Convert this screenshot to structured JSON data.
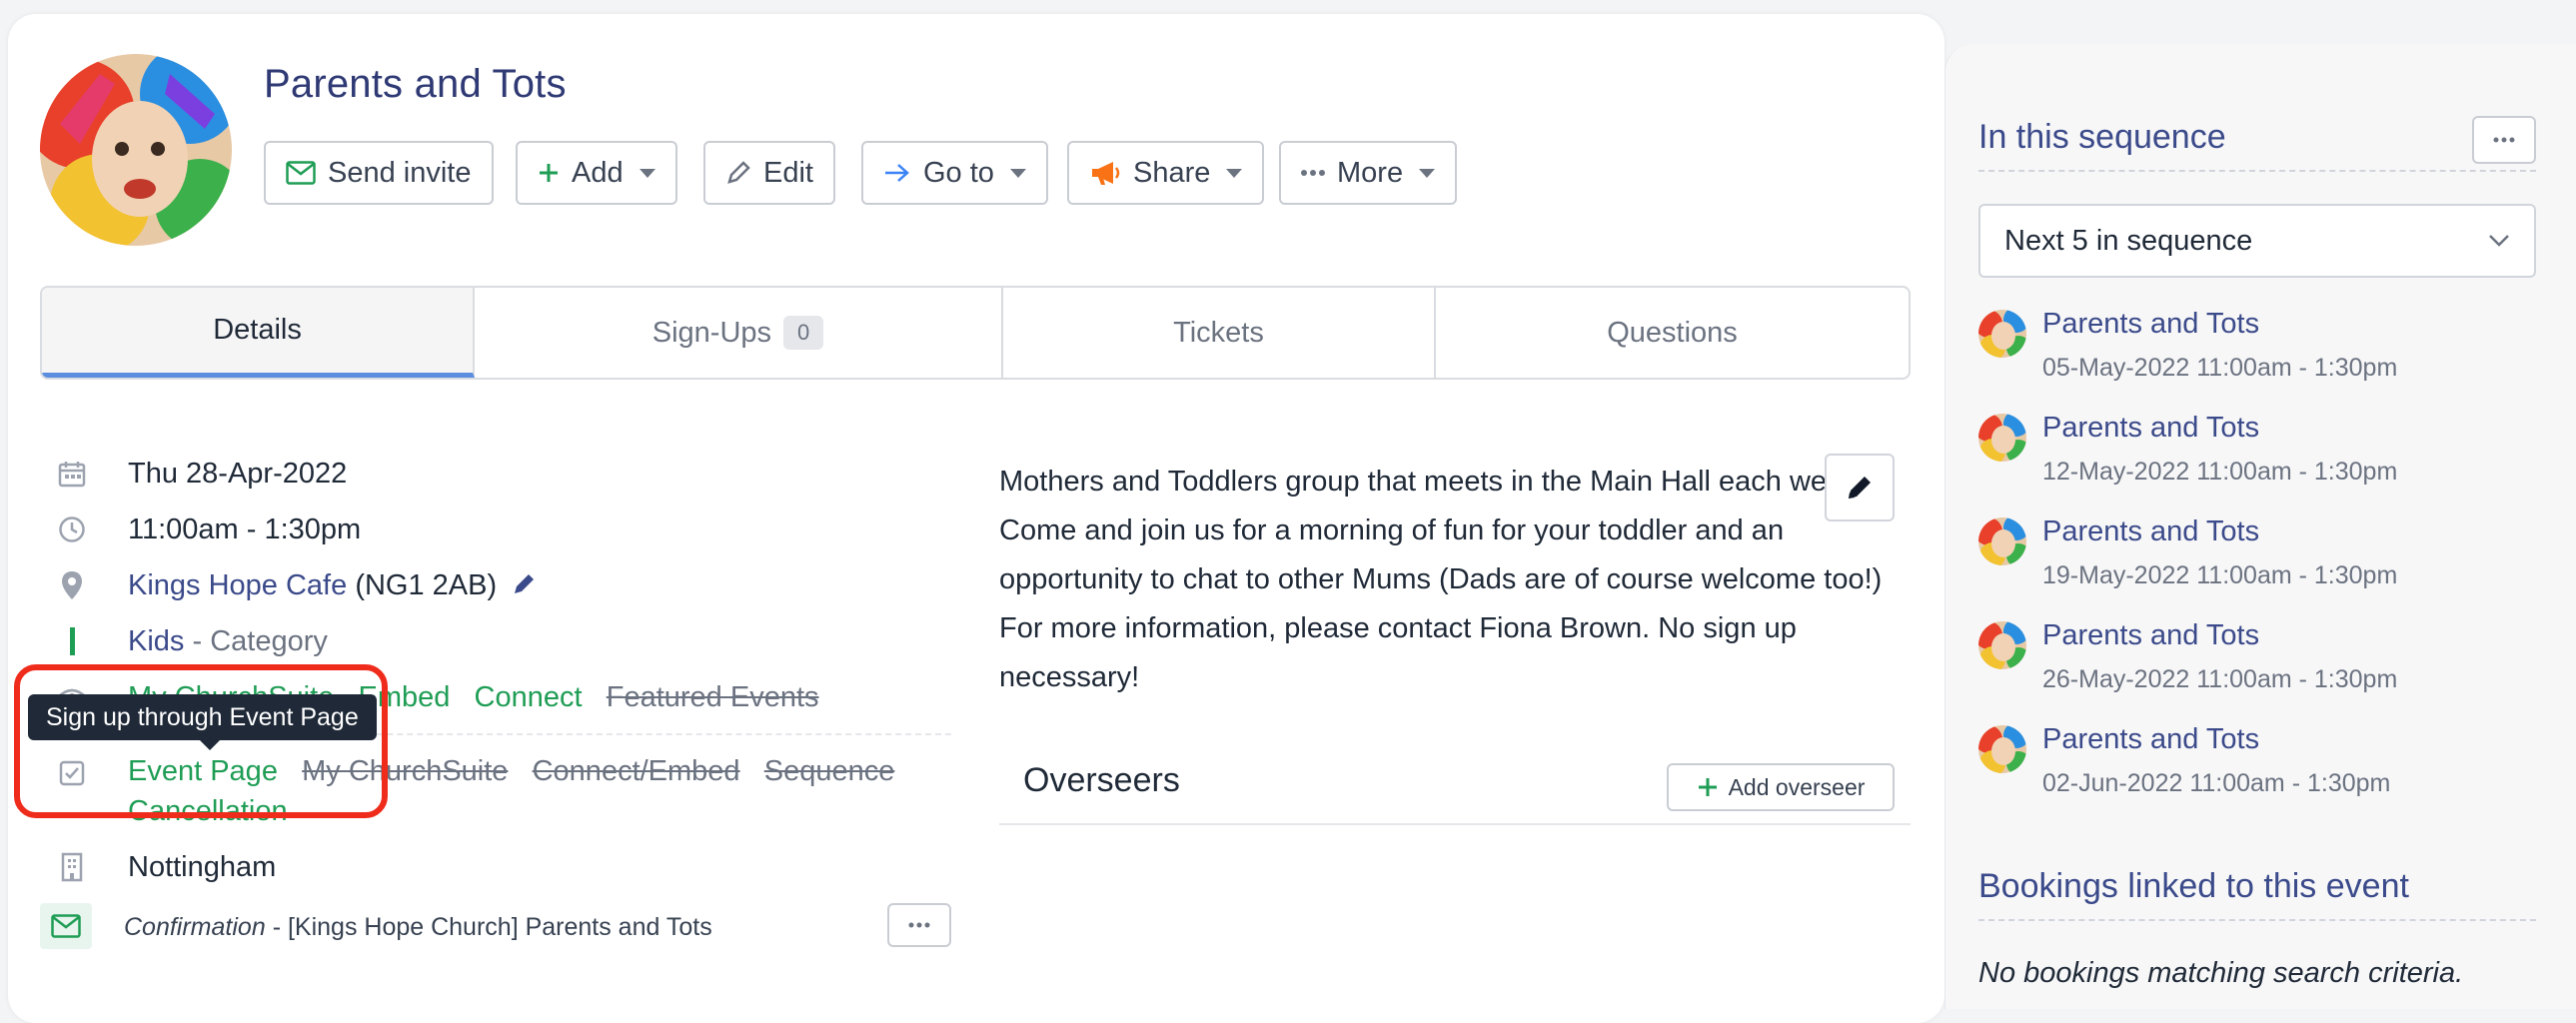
{
  "event": {
    "title": "Parents and Tots"
  },
  "toolbar": {
    "send_invite": "Send invite",
    "add": "Add",
    "edit": "Edit",
    "goto": "Go to",
    "share": "Share",
    "more": "More"
  },
  "tabs": {
    "details": "Details",
    "signups": "Sign-Ups",
    "signups_count": "0",
    "tickets": "Tickets",
    "questions": "Questions"
  },
  "details": {
    "date": "Thu 28-Apr-2022",
    "time": "11:00am - 1:30pm",
    "location_name": "Kings Hope Cafe",
    "location_postcode": "(NG1 2AB)",
    "category_name": "Kids",
    "category_suffix": "- Category",
    "visibility": {
      "mychurchsuite": "My ChurchSuite",
      "embed": "Embed",
      "connect": "Connect",
      "featured": "Featured Events"
    },
    "signup": {
      "event_page": "Event Page",
      "mychurchsuite": "My ChurchSuite",
      "connect_embed": "Connect/Embed",
      "sequence": "Sequence",
      "cancellation": "Cancellation"
    },
    "site": "Nottingham",
    "confirmation_label": "Confirmation",
    "confirmation_text": "- [Kings Hope Church] Parents and Tots"
  },
  "tooltip": {
    "text": "Sign up through Event Page"
  },
  "description": {
    "text": "Mothers and Toddlers group that meets in the Main Hall each week. Come and join us for a morning of fun for your toddler and an opportunity to chat to other Mums (Dads are of course welcome too!) For more information, please contact Fiona Brown. No sign up necessary!"
  },
  "overseers": {
    "heading": "Overseers",
    "add_button": "Add overseer"
  },
  "sequence": {
    "heading": "In this sequence",
    "select_value": "Next 5 in sequence",
    "items": [
      {
        "title": "Parents and Tots",
        "date": "05-May-2022 11:00am - 1:30pm"
      },
      {
        "title": "Parents and Tots",
        "date": "12-May-2022 11:00am - 1:30pm"
      },
      {
        "title": "Parents and Tots",
        "date": "19-May-2022 11:00am - 1:30pm"
      },
      {
        "title": "Parents and Tots",
        "date": "26-May-2022 11:00am - 1:30pm"
      },
      {
        "title": "Parents and Tots",
        "date": "02-Jun-2022 11:00am - 1:30pm"
      }
    ]
  },
  "bookings": {
    "heading": "Bookings linked to this event",
    "empty": "No bookings matching search criteria."
  },
  "colors": {
    "accent_link": "#3b4a8a",
    "status_green": "#1f9d55",
    "highlight_red": "#ef2b1c",
    "tab_active_underline": "#5b8ede"
  }
}
